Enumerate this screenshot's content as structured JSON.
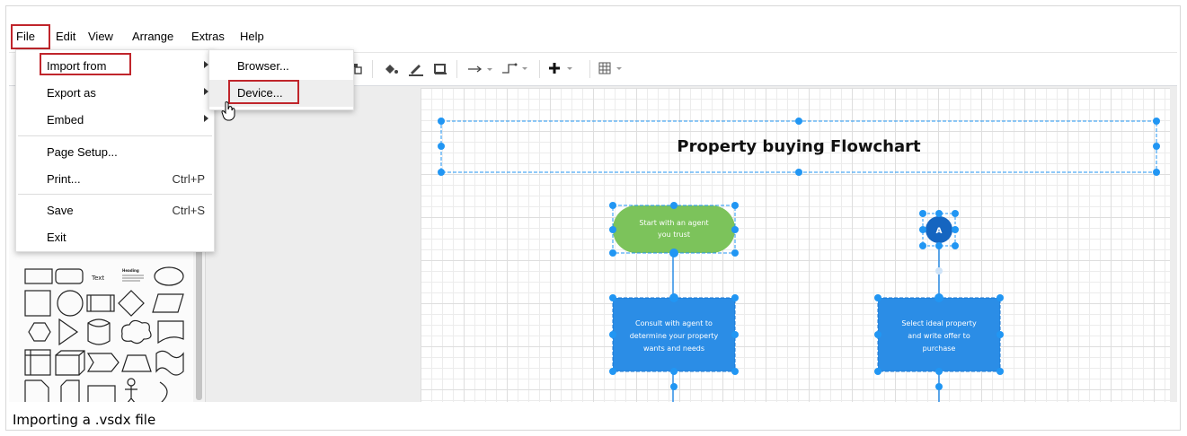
{
  "menubar": {
    "items": [
      "File",
      "Edit",
      "View",
      "Arrange",
      "Extras",
      "Help"
    ]
  },
  "file_menu": {
    "items": [
      {
        "label": "Import from",
        "shortcut": "",
        "submenu": true
      },
      {
        "label": "Export as",
        "shortcut": "",
        "submenu": true
      },
      {
        "label": "Embed",
        "shortcut": "",
        "submenu": true
      },
      {
        "label": "Page Setup...",
        "shortcut": ""
      },
      {
        "label": "Print...",
        "shortcut": "Ctrl+P"
      },
      {
        "label": "Save",
        "shortcut": "Ctrl+S"
      },
      {
        "label": "Exit",
        "shortcut": ""
      }
    ]
  },
  "import_submenu": {
    "items": [
      "Browser...",
      "Device..."
    ]
  },
  "shapes": {
    "text_label": "Text",
    "heading_label": "Heading"
  },
  "diagram": {
    "title": "Property buying Flowchart",
    "start_node": "Start with an agent you trust",
    "connector_label": "A",
    "consult_node": "Consult with agent to determine your property wants and needs",
    "select_node": "Select ideal property and write offer to purchase",
    "colors": {
      "start_fill": "#7cc35b",
      "process_fill": "#2b8de6",
      "connector_fill": "#1565c0",
      "selection": "#2196f3",
      "highlight": "#c0252b"
    }
  },
  "caption": "Importing a .vsdx file"
}
